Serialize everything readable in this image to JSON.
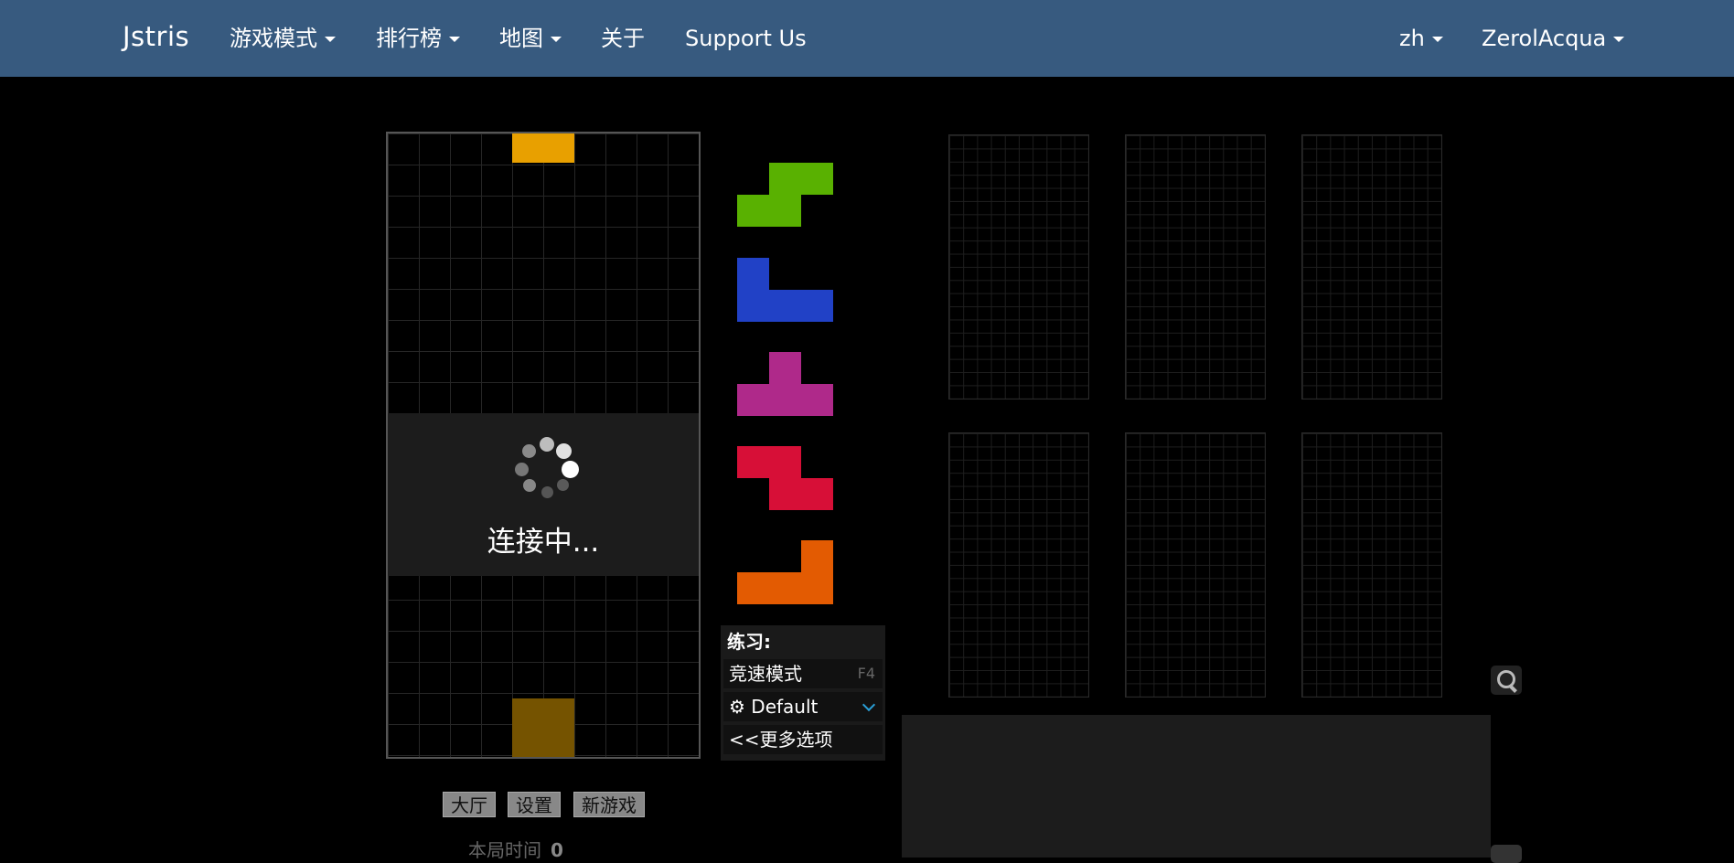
{
  "navbar": {
    "brand": "Jstris",
    "menu": [
      "游戏模式",
      "排行榜",
      "地图",
      "关于"
    ],
    "support": "Support Us",
    "lang": "zh",
    "user": "ZerolAcqua"
  },
  "board": {
    "overlay_text": "连接中...",
    "active_color": "#e8a000",
    "ghost_color": "#755300"
  },
  "queue": {
    "pieces": [
      {
        "name": "S",
        "color": "#59b101"
      },
      {
        "name": "J",
        "color": "#2141c6"
      },
      {
        "name": "T",
        "color": "#af298a"
      },
      {
        "name": "Z",
        "color": "#d70f37"
      },
      {
        "name": "L",
        "color": "#e35b02"
      }
    ]
  },
  "practice": {
    "title": "练习:",
    "mode": "竞速模式",
    "mode_key": "F4",
    "preset": "Default",
    "more": "<<更多选项"
  },
  "buttons": {
    "lobby": "大厅",
    "settings": "设置",
    "new_game": "新游戏"
  },
  "stats": {
    "time_label": "本局时间",
    "time_value": "0"
  },
  "icons": {
    "settings_gear": "gear-icon",
    "zoom": "zoom-in-icon",
    "spinner": "loading-spinner-icon"
  }
}
